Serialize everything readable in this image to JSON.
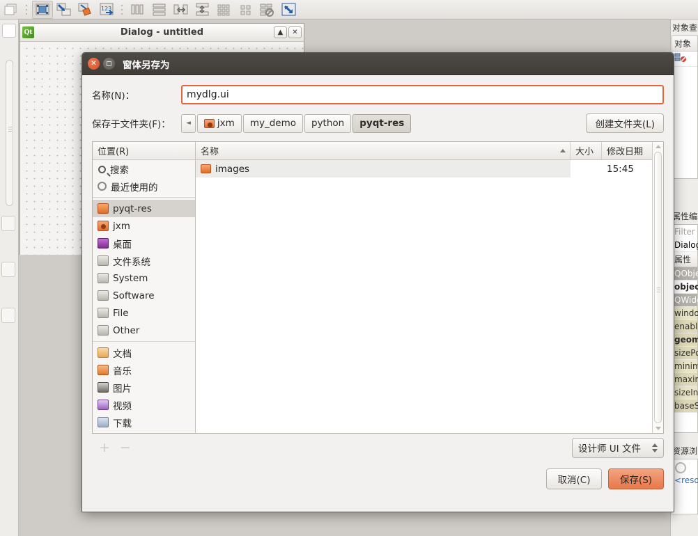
{
  "designer": {
    "toolbar_icons": [
      "new-form-icon",
      "separator",
      "edit-widgets-icon",
      "edit-signals-slots-icon",
      "edit-buddies-icon",
      "edit-tab-order-icon",
      "separator",
      "layout-horizontally-icon",
      "layout-vertically-icon",
      "layout-horizontal-splitter-icon",
      "layout-vertical-splitter-icon",
      "layout-grid-icon",
      "layout-form-icon",
      "break-layout-icon",
      "adjust-size-icon"
    ],
    "form_window": {
      "title": "Dialog - untitled",
      "app_icon": "Qt",
      "minimize_label": "▲",
      "close_label": "✕"
    },
    "object_inspector": {
      "panel_title": "对象查看器",
      "column_header": "对象"
    },
    "property_editor": {
      "panel_title": "属性编辑器",
      "filter_placeholder": "Filter",
      "object_name": "Dialog",
      "column_header": "属性",
      "rows": [
        {
          "label": "QObject",
          "kind": "group"
        },
        {
          "label": "objectName",
          "kind": "bold"
        },
        {
          "label": "QWidget",
          "kind": "group"
        },
        {
          "label": "windowModality",
          "kind": "prop"
        },
        {
          "label": "enabled",
          "kind": "prop"
        },
        {
          "label": "geometry",
          "kind": "prop-bold"
        },
        {
          "label": "sizePolicy",
          "kind": "prop"
        },
        {
          "label": "minimumSize",
          "kind": "prop"
        },
        {
          "label": "maximumSize",
          "kind": "prop"
        },
        {
          "label": "sizeIncrement",
          "kind": "prop"
        },
        {
          "label": "baseSize",
          "kind": "prop"
        }
      ]
    },
    "resource_browser": {
      "panel_title": "资源浏览器",
      "root_label": "<resource root>"
    }
  },
  "dialog": {
    "title": "窗体另存为",
    "close_label": "✕",
    "name_field": {
      "label": "名称(N)：",
      "value": "mydlg.ui",
      "placeholder": ""
    },
    "path_field": {
      "label": "保存于文件夹(F)：",
      "back_arrow": "◄",
      "crumbs": [
        {
          "label": "jxm",
          "icon": "home-folder-icon",
          "active": false
        },
        {
          "label": "my_demo",
          "icon": "",
          "active": false
        },
        {
          "label": "python",
          "icon": "",
          "active": false
        },
        {
          "label": "pyqt-res",
          "icon": "",
          "active": true
        }
      ],
      "create_folder_label": "创建文件夹(L)"
    },
    "places": {
      "header": "位置(R)",
      "items": [
        {
          "label": "搜索",
          "icon": "search-icon",
          "selected": false
        },
        {
          "label": "最近使用的",
          "icon": "recent-icon",
          "selected": false
        },
        {
          "separator": true
        },
        {
          "label": "pyqt-res",
          "icon": "folder-icon",
          "selected": true
        },
        {
          "label": "jxm",
          "icon": "home-icon",
          "selected": false
        },
        {
          "label": "桌面",
          "icon": "desktop-icon",
          "selected": false
        },
        {
          "label": "文件系统",
          "icon": "drive-icon",
          "selected": false
        },
        {
          "label": "System",
          "icon": "drive-icon",
          "selected": false
        },
        {
          "label": "Software",
          "icon": "drive-icon",
          "selected": false
        },
        {
          "label": "File",
          "icon": "drive-icon",
          "selected": false
        },
        {
          "label": "Other",
          "icon": "drive-icon",
          "selected": false
        },
        {
          "separator": true
        },
        {
          "label": "文档",
          "icon": "documents-icon",
          "selected": false
        },
        {
          "label": "音乐",
          "icon": "music-icon",
          "selected": false
        },
        {
          "label": "图片",
          "icon": "pictures-icon",
          "selected": false
        },
        {
          "label": "视频",
          "icon": "videos-icon",
          "selected": false
        },
        {
          "label": "下载",
          "icon": "downloads-icon",
          "selected": false
        }
      ],
      "add_label": "+",
      "remove_label": "−"
    },
    "file_list": {
      "columns": [
        {
          "key": "name",
          "label": "名称",
          "sorted": true,
          "sort_dir": "asc"
        },
        {
          "key": "size",
          "label": "大小",
          "sorted": false
        },
        {
          "key": "date",
          "label": "修改日期",
          "sorted": false
        }
      ],
      "rows": [
        {
          "name": "images",
          "icon": "folder-icon",
          "size": "",
          "date": "15:45"
        }
      ]
    },
    "filter_combo": {
      "value": "设计师 UI 文件",
      "options": [
        "设计师 UI 文件"
      ]
    },
    "buttons": {
      "cancel": "取消(C)",
      "save": "保存(S)"
    }
  },
  "colors": {
    "accent_orange": "#e8643c",
    "save_button": "#e8784b",
    "titlebar_dark": "#4e4a46",
    "selection_gray": "#d6d3ce",
    "property_row": "#ded9b8"
  }
}
